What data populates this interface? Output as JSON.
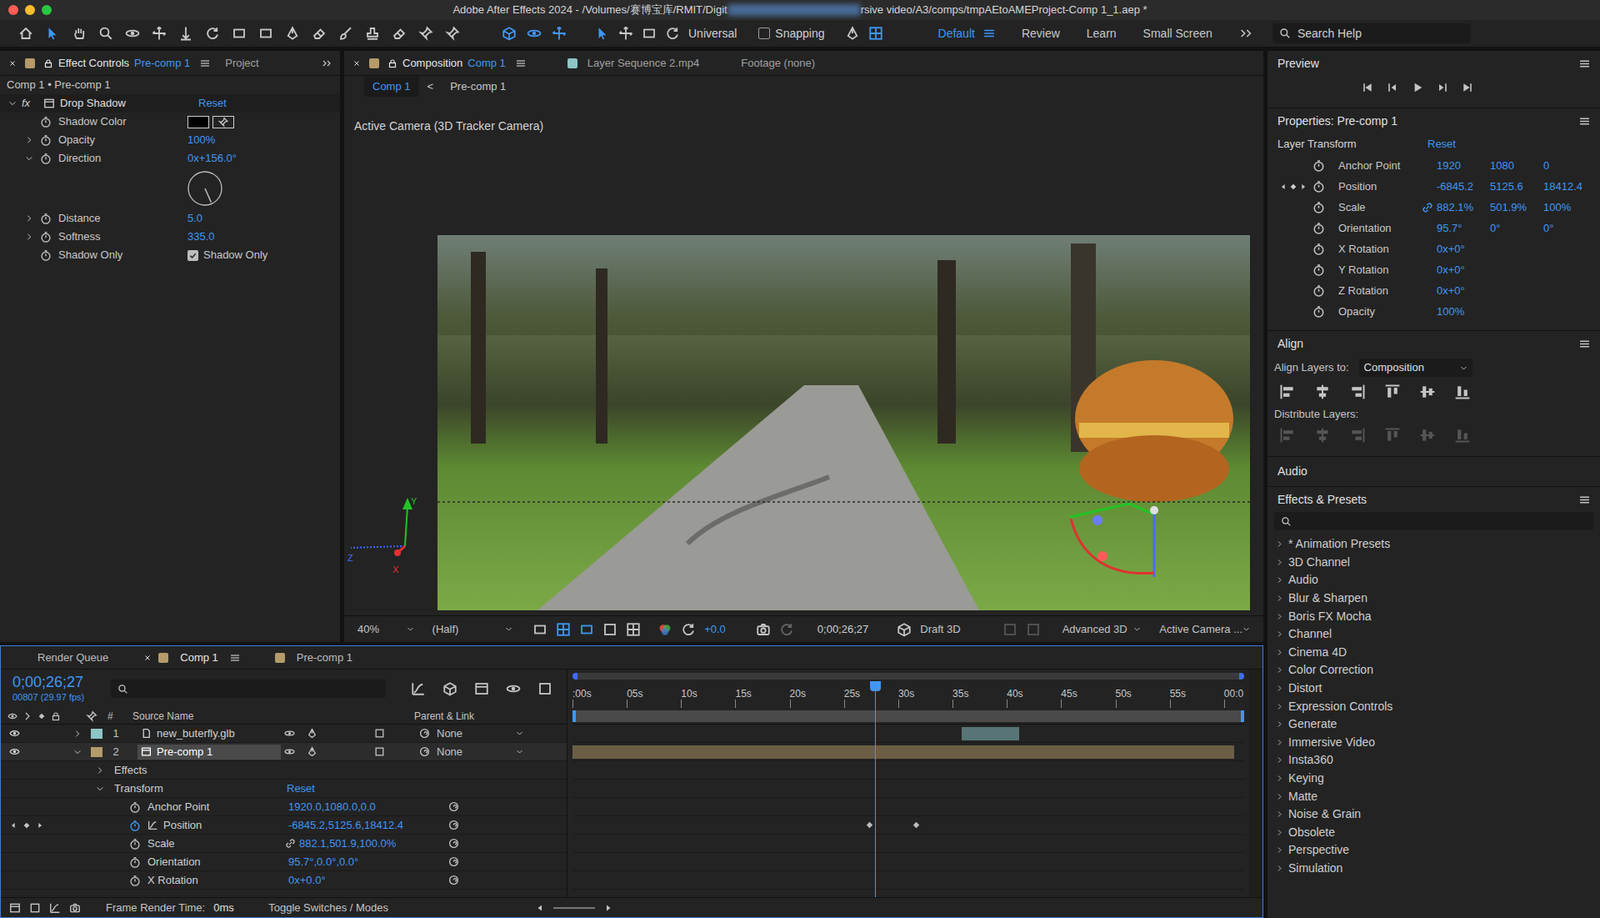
{
  "window": {
    "title_start": "Adobe After Effects 2024 - /Volumes/赛博宝库/RMIT/Digit",
    "title_end": "rsive video/A3/comps/tmpAEtoAMEProject-Comp 1_1.aep *"
  },
  "toolbar": {
    "universal": "Universal",
    "snapping": {
      "label": "Snapping",
      "checked": false
    },
    "workspaces": [
      {
        "label": "Default",
        "selected": true
      },
      {
        "label": "Review",
        "selected": false
      },
      {
        "label": "Learn",
        "selected": false
      },
      {
        "label": "Small Screen",
        "selected": false
      }
    ],
    "search": {
      "placeholder": "Search Help"
    }
  },
  "effect_controls": {
    "tabs": [
      {
        "label": "Effect Controls",
        "target": "Pre-comp 1",
        "selected": true
      },
      {
        "label": "Project",
        "selected": false
      }
    ],
    "breadcrumb": "Comp 1 • Pre-comp 1",
    "effect": {
      "badge": "fx",
      "name": "Drop Shadow",
      "reset": "Reset",
      "expanded": true
    },
    "params": [
      {
        "kind": "color",
        "label": "Shadow Color",
        "color": "#000000"
      },
      {
        "kind": "value",
        "label": "Opacity",
        "value": "100%",
        "expanded": false
      },
      {
        "kind": "angle",
        "label": "Direction",
        "value": "0x+156.0°",
        "expanded": true,
        "angle": 156
      },
      {
        "kind": "value",
        "label": "Distance",
        "value": "5.0",
        "expanded": false
      },
      {
        "kind": "value",
        "label": "Softness",
        "value": "335.0",
        "expanded": false
      },
      {
        "kind": "check",
        "label": "Shadow Only",
        "value": "Shadow Only",
        "checked": true
      }
    ]
  },
  "composition": {
    "tabs": [
      {
        "label": "Composition",
        "target": "Comp 1",
        "selected": true
      },
      {
        "label": "Layer Sequence 2.mp4",
        "selected": false
      },
      {
        "label": "Footage (none)",
        "selected": false
      }
    ],
    "subtabs": [
      {
        "label": "Comp 1",
        "selected": true
      },
      {
        "label": "Pre-comp 1",
        "selected": false
      }
    ],
    "separator": "<",
    "camera": "Active Camera (3D Tracker Camera)",
    "axes": {
      "x": "X",
      "y": "Y",
      "z": "Z"
    },
    "bar": {
      "zoom": "40%",
      "resolution": "(Half)",
      "exposure": "+0.0",
      "timecode": "0;00;26;27",
      "draft": "Draft 3D",
      "renderer": "Advanced 3D",
      "view": "Active Camera ..."
    }
  },
  "preview": {
    "title": "Preview"
  },
  "properties": {
    "title": "Properties: Pre-comp 1",
    "section": "Layer Transform",
    "reset": "Reset",
    "rows": [
      {
        "label": "Anchor Point",
        "values": [
          "1920",
          "1080",
          "0"
        ],
        "keyframed": false,
        "linked": false
      },
      {
        "label": "Position",
        "values": [
          "-6845.2",
          "5125.6",
          "18412.4"
        ],
        "keyframed": true,
        "linked": false
      },
      {
        "label": "Scale",
        "values": [
          "882.1%",
          "501.9%",
          "100%"
        ],
        "keyframed": false,
        "linked": true
      },
      {
        "label": "Orientation",
        "values": [
          "95.7°",
          "0°",
          "0°"
        ],
        "keyframed": false,
        "linked": false
      },
      {
        "label": "X Rotation",
        "values": [
          "0x+0°"
        ],
        "keyframed": false,
        "linked": false
      },
      {
        "label": "Y Rotation",
        "values": [
          "0x+0°"
        ],
        "keyframed": false,
        "linked": false
      },
      {
        "label": "Z Rotation",
        "values": [
          "0x+0°"
        ],
        "keyframed": false,
        "linked": false
      },
      {
        "label": "Opacity",
        "values": [
          "100%"
        ],
        "keyframed": false,
        "linked": false
      }
    ]
  },
  "align": {
    "title": "Align",
    "align_to_label": "Align Layers to:",
    "align_to": "Composition",
    "distribute_label": "Distribute Layers:"
  },
  "audio": {
    "title": "Audio"
  },
  "effects_presets": {
    "title": "Effects & Presets",
    "items": [
      "* Animation Presets",
      "3D Channel",
      "Audio",
      "Blur & Sharpen",
      "Boris FX Mocha",
      "Channel",
      "Cinema 4D",
      "Color Correction",
      "Distort",
      "Expression Controls",
      "Generate",
      "Immersive Video",
      "Insta360",
      "Keying",
      "Matte",
      "Noise & Grain",
      "Obsolete",
      "Perspective",
      "Simulation"
    ]
  },
  "timeline": {
    "tabs": [
      {
        "label": "Render Queue",
        "selected": false
      },
      {
        "label": "Comp 1",
        "selected": true
      },
      {
        "label": "Pre-comp 1",
        "selected": false
      }
    ],
    "timecode": "0;00;26;27",
    "frames": "00807 (29.97 fps)",
    "columns": {
      "num": "#",
      "source": "Source Name",
      "parent": "Parent & Link"
    },
    "layers": [
      {
        "num": "1",
        "name": "new_buterfly.glb",
        "parent": "None",
        "selected": false,
        "expanded": false,
        "visible": true,
        "color": "#8ec5c5",
        "bar_start": 0.58,
        "bar_end": 0.665
      },
      {
        "num": "2",
        "name": "Pre-comp 1",
        "parent": "None",
        "selected": true,
        "expanded": true,
        "visible": true,
        "color": "#b59a6a",
        "bar_start": 0,
        "bar_end": 0.985
      }
    ],
    "props": [
      {
        "kind": "group",
        "label": "Effects",
        "expanded": false
      },
      {
        "kind": "group",
        "label": "Transform",
        "expanded": true,
        "reset": "Reset"
      },
      {
        "kind": "prop",
        "label": "Anchor Point",
        "value": "1920.0,1080.0,0.0",
        "keyframed": false,
        "linked": false,
        "keyframes": []
      },
      {
        "kind": "prop",
        "label": "Position",
        "value": "-6845.2,5125.6,18412.4",
        "keyframed": true,
        "linked": false,
        "keyframes": [
          0.442,
          0.511
        ]
      },
      {
        "kind": "prop",
        "label": "Scale",
        "value": "882.1,501.9,100.0%",
        "keyframed": false,
        "linked": true,
        "keyframes": []
      },
      {
        "kind": "prop",
        "label": "Orientation",
        "value": "95.7°,0.0°,0.0°",
        "keyframed": false,
        "linked": false,
        "keyframes": []
      },
      {
        "kind": "prop",
        "label": "X Rotation",
        "value": "0x+0.0°",
        "keyframed": false,
        "linked": false,
        "keyframes": []
      }
    ],
    "ruler": [
      ":00s",
      "05s",
      "10s",
      "15s",
      "20s",
      "25s",
      "30s",
      "35s",
      "40s",
      "45s",
      "50s",
      "55s",
      "00:0"
    ],
    "playhead": 0.45,
    "footer": {
      "render_label": "Frame Render Time:",
      "render_time": "0ms",
      "toggle": "Toggle Switches / Modes"
    }
  }
}
